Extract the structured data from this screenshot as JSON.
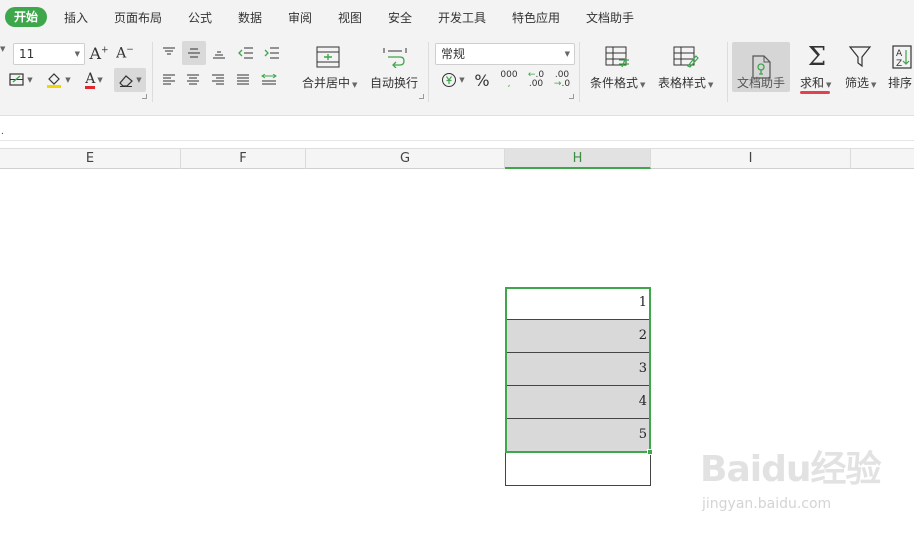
{
  "menu": {
    "tabs": [
      "开始",
      "插入",
      "页面布局",
      "公式",
      "数据",
      "审阅",
      "视图",
      "安全",
      "开发工具",
      "特色应用",
      "文档助手"
    ],
    "active_index": 0
  },
  "ribbon": {
    "font_size_value": "11",
    "number_format_value": "常规",
    "merge_center_label": "合并居中",
    "wrap_text_label": "自动换行",
    "conditional_format_label": "条件格式",
    "table_style_label": "表格样式",
    "doc_helper_label": "文档助手",
    "sum_label": "求和",
    "filter_label": "筛选",
    "sort_label": "排序",
    "increase_font_glyph": "A",
    "decrease_font_glyph": "A",
    "font_color_glyph": "A",
    "percent_glyph": "%",
    "thousands_glyph": "000",
    "inc_decimal_glyph": ".00",
    "dec_decimal_glyph": ".00",
    "sum_glyph": "Σ",
    "sort_glyph": "A↓Z",
    "accent_color": "#3ea64b",
    "sum_underline_color": "#e0434f"
  },
  "columns": [
    "E",
    "F",
    "G",
    "H",
    "I"
  ],
  "selected_column": "H",
  "cells": [
    "1",
    "2",
    "3",
    "4",
    "5"
  ],
  "watermark": {
    "logo": "Baidu经验",
    "url": "jingyan.baidu.com"
  }
}
